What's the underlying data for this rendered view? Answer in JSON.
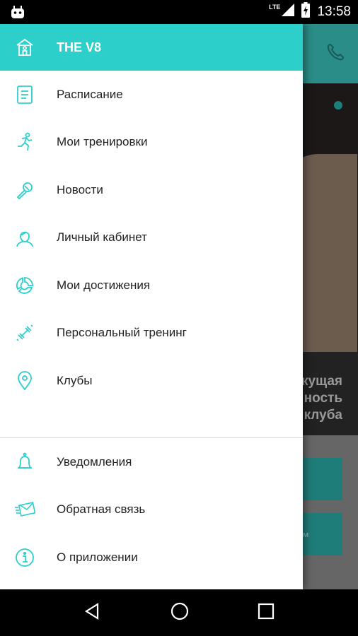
{
  "status_bar": {
    "network": "LTE",
    "time": "13:58"
  },
  "drawer": {
    "header_title": "THE V8",
    "items": [
      {
        "label": "Расписание",
        "icon": "schedule-icon"
      },
      {
        "label": "Мои тренировки",
        "icon": "running-icon"
      },
      {
        "label": "Новости",
        "icon": "microphone-icon"
      },
      {
        "label": "Личный кабинет",
        "icon": "profile-icon"
      },
      {
        "label": "Мои достижения",
        "icon": "achievements-icon"
      },
      {
        "label": "Персональный тренинг",
        "icon": "dumbbell-icon"
      },
      {
        "label": "Клубы",
        "icon": "location-pin-icon"
      }
    ],
    "secondary_items": [
      {
        "label": "Уведомления",
        "icon": "bell-icon"
      },
      {
        "label": "Обратная связь",
        "icon": "envelope-icon"
      },
      {
        "label": "О приложении",
        "icon": "info-icon"
      }
    ]
  },
  "background": {
    "caption_lines": [
      "кущая",
      "ность",
      "клуба"
    ],
    "button_text": "м"
  },
  "colors": {
    "accent": "#2dcfcb",
    "icon": "#2dcfcb"
  }
}
